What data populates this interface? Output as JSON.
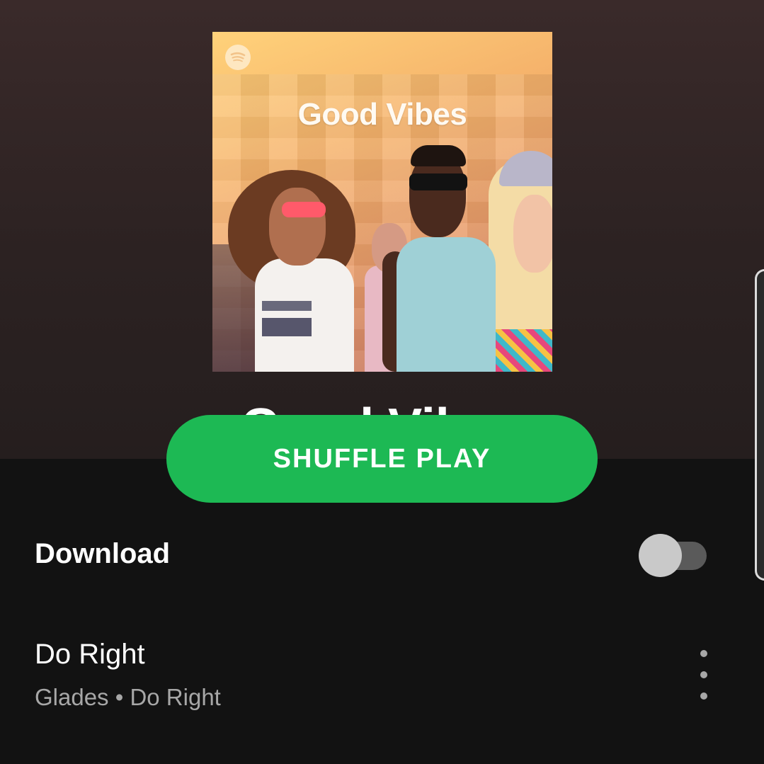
{
  "playlist": {
    "cover_title": "Good Vibes",
    "title": "Good Vibes",
    "shuffle_label": "SHUFFLE PLAY",
    "cover_logo": "spotify-logo-icon"
  },
  "download": {
    "label": "Download",
    "enabled": false
  },
  "tracks": [
    {
      "title": "Do Right",
      "artist": "Glades",
      "album": "Do Right",
      "meta": "Glades • Do Right"
    }
  ],
  "colors": {
    "accent": "#1db954",
    "background": "#121212",
    "header_gradient_top": "#3a2a2a",
    "secondary_text": "#a7a7a7"
  }
}
